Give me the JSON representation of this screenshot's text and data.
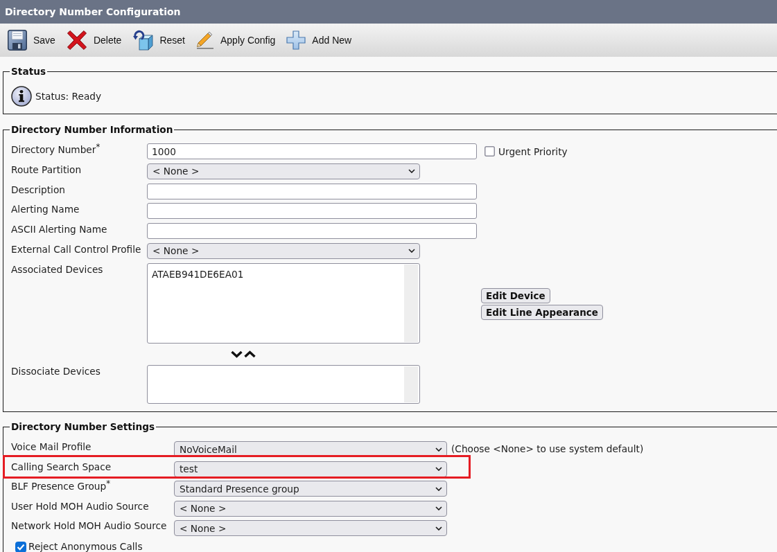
{
  "window": {
    "title": "Directory Number Configuration"
  },
  "toolbar": [
    {
      "kind": "save",
      "label": "Save"
    },
    {
      "kind": "delete",
      "label": "Delete"
    },
    {
      "kind": "reset",
      "label": "Reset"
    },
    {
      "kind": "apply",
      "label": "Apply Config"
    },
    {
      "kind": "add",
      "label": "Add New"
    }
  ],
  "status": {
    "legend": "Status",
    "message": "Status: Ready"
  },
  "directory_number_information": {
    "legend": "Directory Number Information",
    "rows": [
      {
        "kind": "text",
        "label": "Directory Number$^{*}$",
        "value": "1000",
        "checkbox": {
          "label": "Urgent Priority",
          "checked": false
        }
      },
      {
        "kind": "select",
        "label": "Route Partition",
        "value": "< None >"
      },
      {
        "kind": "text",
        "label": "Description"
      },
      {
        "kind": "text",
        "label": "Alerting Name"
      },
      {
        "kind": "text",
        "label": "ASCII Alerting Name"
      },
      {
        "kind": "select",
        "label": "External Call Control Profile",
        "value": "< None >"
      },
      {
        "kind": "listbox",
        "label": "Associated Devices",
        "items": [
          "ATAEB941DE6EA01"
        ],
        "buttons": [
          "Edit Device",
          "Edit Line Appearance"
        ]
      },
      {
        "kind": "movebuttons"
      },
      {
        "kind": "shortlistbox",
        "label": "Dissociate Devices"
      }
    ]
  },
  "directory_number_settings": {
    "legend": "Directory Number Settings",
    "rows": [
      {
        "kind": "select",
        "label": "Voice Mail Profile",
        "value": "NoVoiceMail",
        "hint": "(Choose <None> to use system default)",
        "highlighted": false
      },
      {
        "kind": "select",
        "label": "Calling Search Space",
        "value": "test",
        "highlighted": true
      },
      {
        "kind": "select",
        "label": "BLF Presence Group$^{*}$",
        "value": "Standard Presence group",
        "highlighted": false
      },
      {
        "kind": "select",
        "label": "User Hold MOH Audio Source",
        "value": "< None >",
        "highlighted": false
      },
      {
        "kind": "select",
        "label": "Network Hold MOH Audio Source",
        "value": "< None >",
        "highlighted": false
      },
      {
        "kind": "checkbox",
        "label": "Reject Anonymous Calls",
        "checked": true,
        "highlighted": false
      }
    ]
  }
}
